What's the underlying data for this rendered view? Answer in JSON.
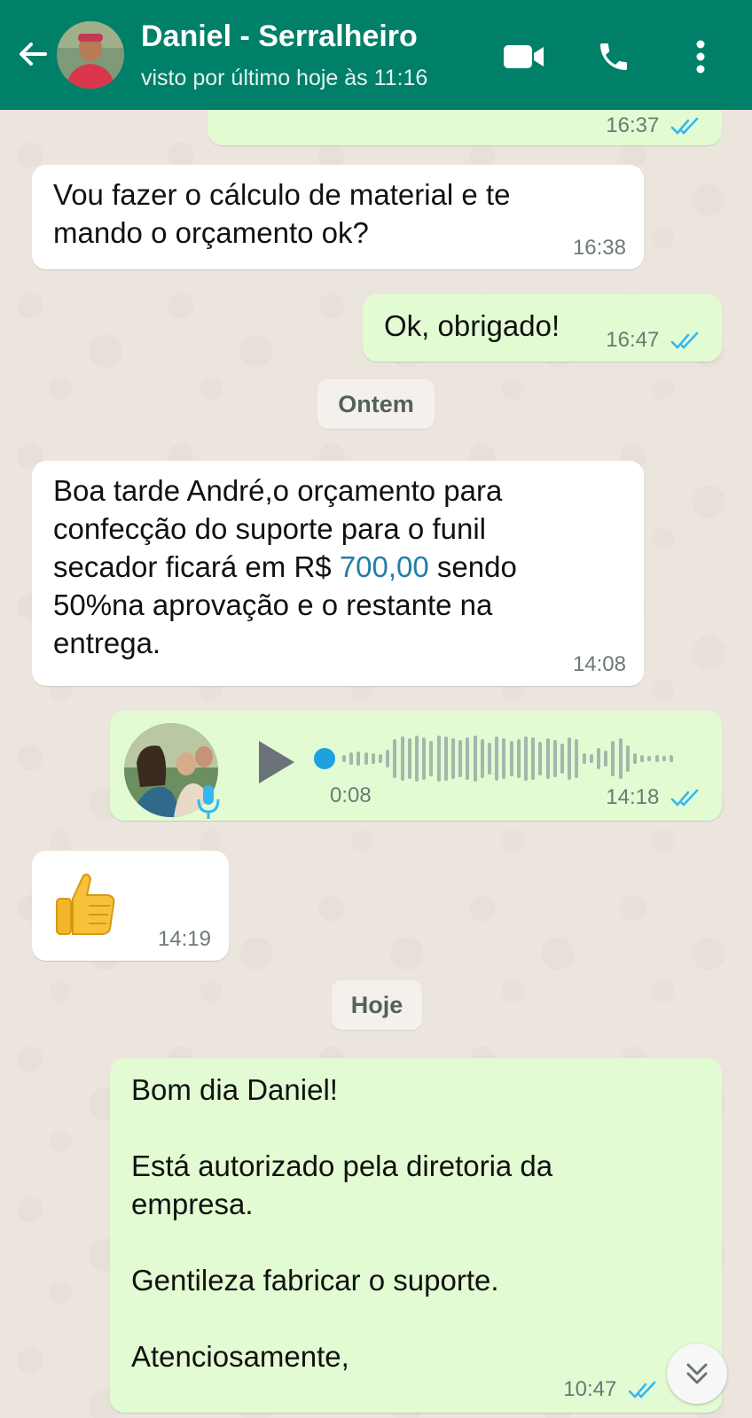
{
  "header": {
    "contact_name": "Daniel - Serralheiro",
    "status": "visto por último hoje às 11:16",
    "accent_color": "#008069"
  },
  "messages": {
    "m0": {
      "time": "16:37"
    },
    "m1": {
      "text": "Vou fazer o cálculo de material e te\nmando o orçamento ok?",
      "time": "16:38"
    },
    "m2": {
      "text": "Ok, obrigado!",
      "time": "16:47"
    },
    "date1": "Ontem",
    "m3": {
      "text_before": "Boa tarde André,o orçamento para\nconfecção do suporte para o funil\nsecador ficará em R$ ",
      "amount": "700,00",
      "text_after": " sendo\n50%na aprovação e o restante na\nentrega.",
      "time": "14:08"
    },
    "m4": {
      "duration": "0:08",
      "time": "14:18",
      "progress": 0.0
    },
    "m5": {
      "emoji": "👍",
      "time": "14:19"
    },
    "date2": "Hoje",
    "m6": {
      "text": "Bom dia Daniel!\n\nEstá autorizado pela diretoria da\nempresa.\n\nGentileza fabricar o suporte.\n\nAtenciosamente,",
      "time": "10:47"
    }
  },
  "icons": {
    "back": "arrow-left-icon",
    "video": "video-camera-icon",
    "call": "phone-icon",
    "menu": "more-vertical-icon",
    "scroll": "double-chevron-down-icon",
    "read": "double-check-icon",
    "mic": "mic-icon",
    "play": "play-icon"
  }
}
